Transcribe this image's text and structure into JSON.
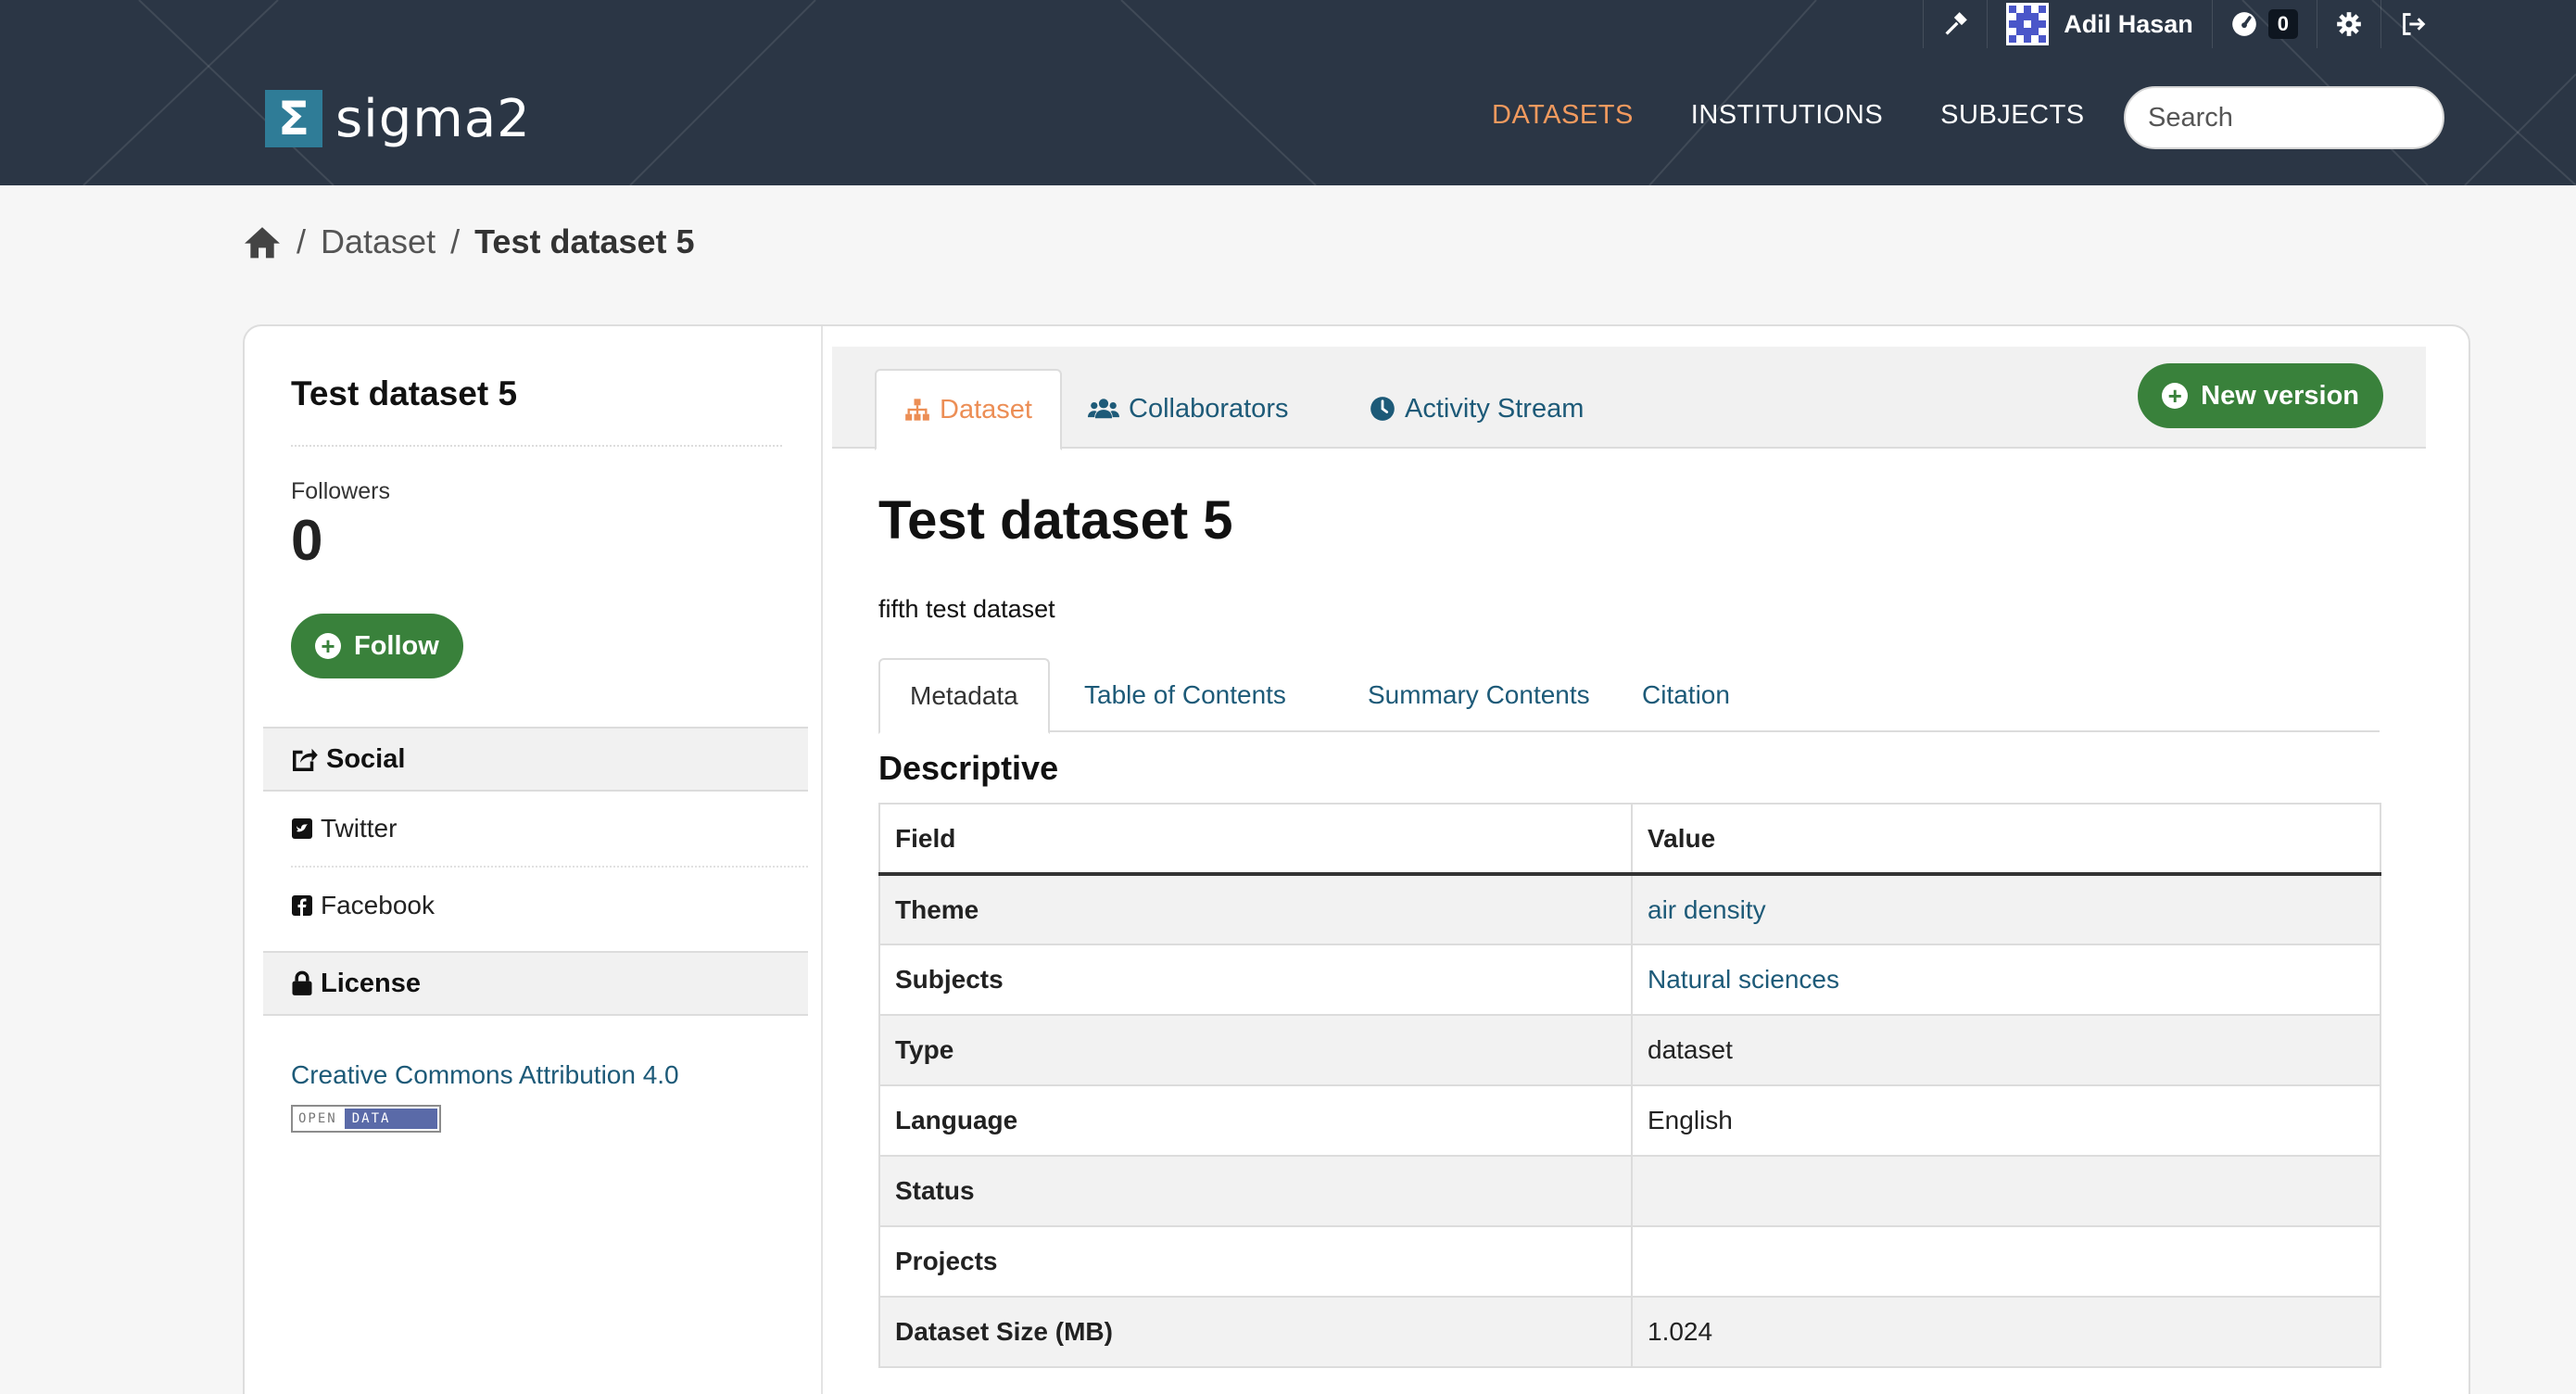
{
  "header": {
    "user_name": "Adil Hasan",
    "notification_count": "0",
    "logo_symbol": "Σ",
    "logo_text": "sigma2",
    "nav": [
      {
        "label": "DATASETS",
        "active": true
      },
      {
        "label": "INSTITUTIONS",
        "active": false
      },
      {
        "label": "SUBJECTS",
        "active": false
      }
    ],
    "search_placeholder": "Search",
    "icons": [
      "sysadmin-hammer-icon",
      "avatar",
      "dashboard-gauge-icon",
      "settings-gear-icon",
      "logout-icon",
      "search-icon"
    ]
  },
  "breadcrumb": {
    "home_icon": "home-icon",
    "items": [
      "Dataset",
      "Test dataset 5"
    ],
    "separator": "/"
  },
  "sidebar": {
    "title": "Test dataset 5",
    "followers_label": "Followers",
    "followers_count": "0",
    "follow_label": "Follow",
    "social_heading": "Social",
    "social_items": [
      "Twitter",
      "Facebook"
    ],
    "license_heading": "License",
    "license_link": "Creative Commons Attribution 4.0",
    "opendata_badge": {
      "left": "OPEN",
      "right": "DATA"
    }
  },
  "content": {
    "tabs": [
      {
        "label": "Dataset",
        "active": true,
        "icon": "sitemap-icon"
      },
      {
        "label": "Collaborators",
        "active": false,
        "icon": "users-icon"
      },
      {
        "label": "Activity Stream",
        "active": false,
        "icon": "clock-icon"
      }
    ],
    "new_version_label": "New version",
    "title": "Test dataset 5",
    "description": "fifth test dataset",
    "subtabs": [
      {
        "label": "Metadata",
        "active": true
      },
      {
        "label": "Table of Contents",
        "active": false
      },
      {
        "label": "Summary Contents",
        "active": false
      },
      {
        "label": "Citation",
        "active": false
      }
    ],
    "section_title": "Descriptive",
    "table": {
      "headers": [
        "Field",
        "Value"
      ],
      "rows": [
        {
          "field": "Theme",
          "value": "air density",
          "link": true
        },
        {
          "field": "Subjects",
          "value": "Natural sciences",
          "link": true
        },
        {
          "field": "Type",
          "value": "dataset",
          "link": false
        },
        {
          "field": "Language",
          "value": "English",
          "link": false
        },
        {
          "field": "Status",
          "value": "",
          "link": false
        },
        {
          "field": "Projects",
          "value": "",
          "link": false
        },
        {
          "field": "Dataset Size (MB)",
          "value": "1.024",
          "link": false
        }
      ]
    }
  },
  "colors": {
    "header_bg": "#2b3645",
    "accent_orange": "#f29a5e",
    "link_blue": "#1d5a78",
    "button_green": "#39813b"
  }
}
